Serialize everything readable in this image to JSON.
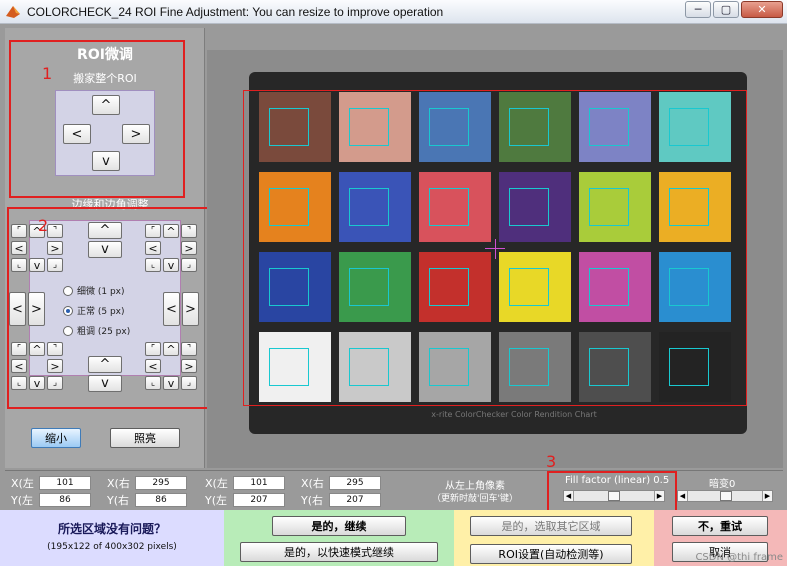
{
  "window": {
    "title": "COLORCHECK_24 ROI Fine Adjustment: You can resize to improve operation",
    "min": "─",
    "max": "▢",
    "close": "✕"
  },
  "roi_panel": {
    "title": "ROI微调",
    "move_label": "搬家整个ROI",
    "up": "^",
    "down": "v",
    "left": "<",
    "right": ">",
    "edge_label": "边缘和边角调整"
  },
  "edge_panel": {
    "corner_tl": "⌜",
    "corner_tr": "⌝",
    "corner_bl": "⌞",
    "corner_br": "⌟",
    "up": "^",
    "down": "v",
    "left": "<",
    "right": ">",
    "radio": [
      {
        "label": "细微  (1 px)",
        "selected": false
      },
      {
        "label": "正常  (5 px)",
        "selected": true
      },
      {
        "label": "粗调  (25 px)",
        "selected": false
      }
    ]
  },
  "zoom": {
    "shrink": "缩小",
    "expand": "照亮"
  },
  "annotations": {
    "one": "1",
    "two": "2",
    "three": "3"
  },
  "checker": {
    "caption": "x-rite ColorChecker Color Rendition Chart",
    "colors": [
      "#7a4a3c",
      "#d39b8c",
      "#4a76b4",
      "#4f7a3f",
      "#7d83c5",
      "#5fc9c2",
      "#e5821e",
      "#3a54b7",
      "#d8525c",
      "#4f2f7c",
      "#a9cc3a",
      "#ebae24",
      "#2945a2",
      "#3a9a4c",
      "#c3302c",
      "#e8d827",
      "#c14ea3",
      "#2a8ed0",
      "#f0f0f0",
      "#c9c9c9",
      "#a6a6a6",
      "#7a7a7a",
      "#4e4e4e",
      "#232323"
    ]
  },
  "coords": {
    "labels": [
      "X(左",
      "X(右",
      "X(左",
      "X(右",
      "Y(左",
      "Y(右",
      "Y(左",
      "Y(右"
    ],
    "values": [
      "101",
      "295",
      "101",
      "295",
      "86",
      "86",
      "207",
      "207"
    ],
    "hint_line1": "从左上角像素",
    "hint_line2": "（更新时敲'回车'键）"
  },
  "fill_factor": {
    "label": "Fill factor (linear) 0.5",
    "value": 0.5
  },
  "vignette": {
    "label": "暗变0",
    "value": 0.5
  },
  "footer": {
    "question": "所选区域没有问题？",
    "size_info": "(195x122 of 400x302 pixels)",
    "yes_continue": "是的，继续",
    "yes_fast": "是的，以快速模式继续",
    "yes_other": "是的，选取其它区域",
    "roi_settings": "ROI设置(自动检测等)",
    "no_retry": "不，重试",
    "cancel": "取消",
    "watermark": "CSDN @thi  frame"
  }
}
